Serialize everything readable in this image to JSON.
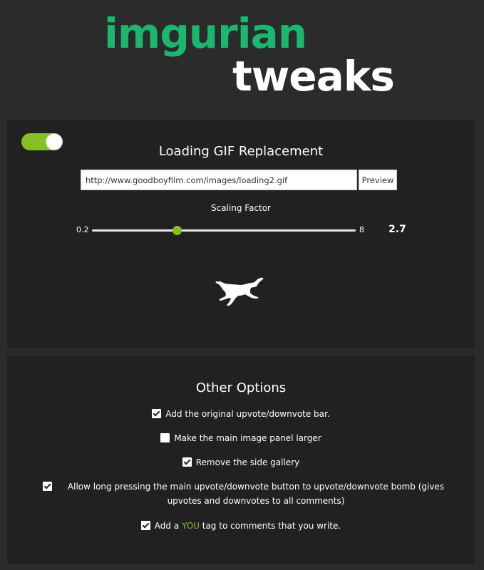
{
  "logo": {
    "line1": "imgurian",
    "line2": "tweaks"
  },
  "gif_panel": {
    "toggle_on": true,
    "title": "Loading GIF Replacement",
    "url_value": "http://www.goodboyfilm.com/images/loading2.gif",
    "preview_label": "Preview",
    "scaling_label": "Scaling Factor",
    "slider_min": "0.2",
    "slider_max": "8",
    "slider_value": "2.7",
    "preview_icon": "running-dog-icon"
  },
  "other_panel": {
    "title": "Other Options",
    "options": [
      {
        "label": "Add the original upvote/downvote bar.",
        "checked": true
      },
      {
        "label": "Make the main image panel larger",
        "checked": false
      },
      {
        "label": "Remove the side gallery",
        "checked": true
      },
      {
        "label": "Allow long pressing the main upvote/downvote button to upvote/downvote bomb (gives upvotes and downvotes to all comments)",
        "checked": true
      },
      {
        "label_prefix": "Add a",
        "label_highlight": "YOU",
        "label_suffix": "tag to comments that you write.",
        "checked": true
      }
    ]
  },
  "colors": {
    "background": "#2b2b2b",
    "panel": "#212121",
    "logo_green": "#1bb76e",
    "accent_green": "#85bf25"
  }
}
